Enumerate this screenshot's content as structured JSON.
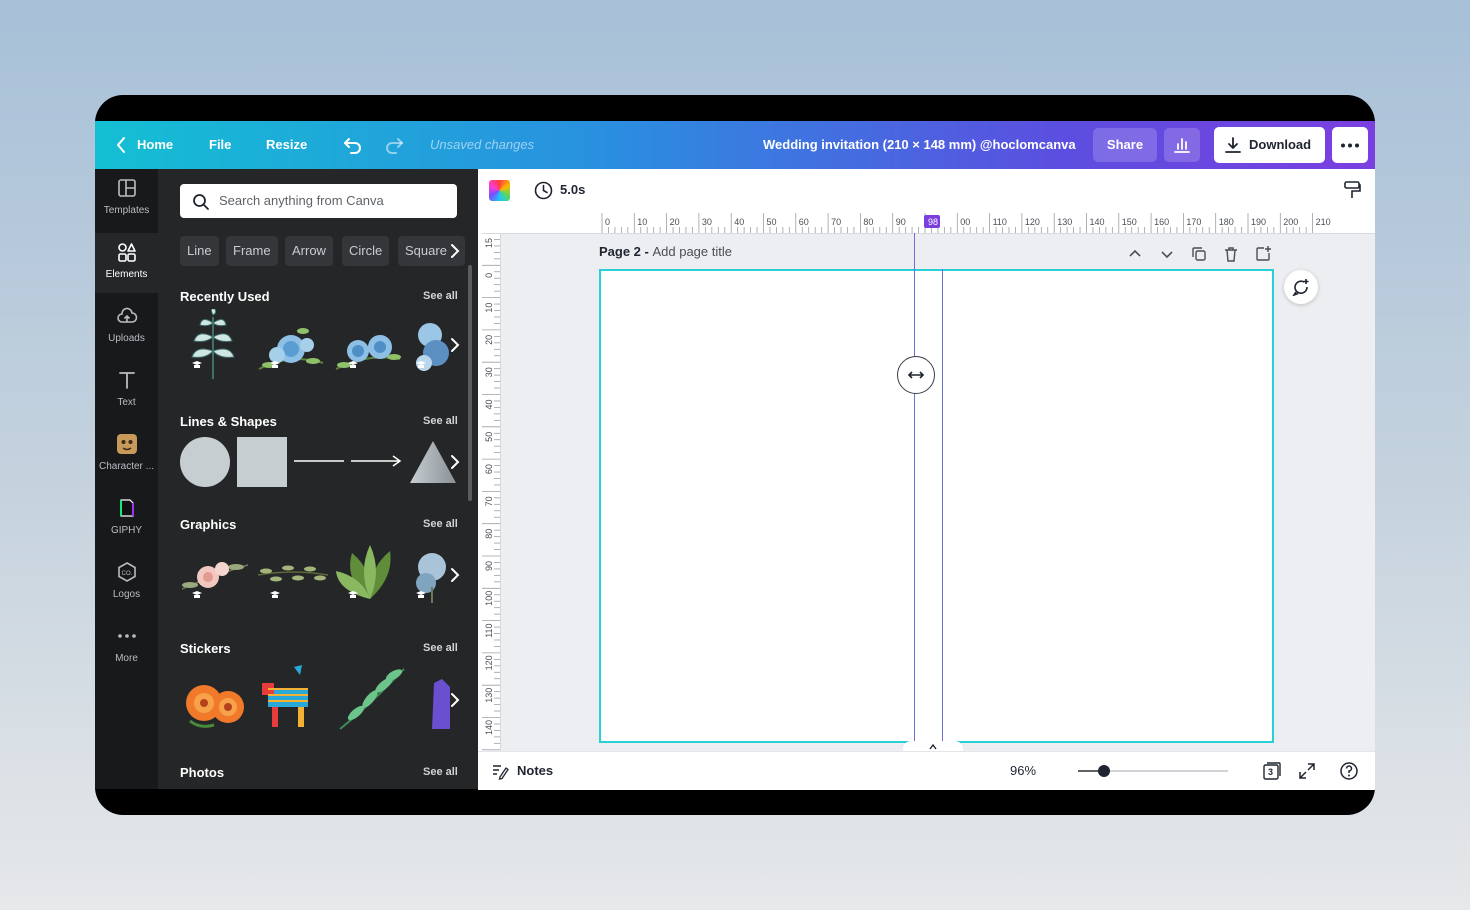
{
  "topbar": {
    "home_label": "Home",
    "file_label": "File",
    "resize_label": "Resize",
    "unsaved": "Unsaved changes",
    "doc_title": "Wedding invitation  (210 × 148 mm) @hoclomcanva",
    "share_label": "Share",
    "download_label": "Download"
  },
  "sidenav": {
    "items": [
      {
        "label": "Templates",
        "icon": "templates-icon"
      },
      {
        "label": "Elements",
        "icon": "elements-icon"
      },
      {
        "label": "Uploads",
        "icon": "upload-cloud-icon"
      },
      {
        "label": "Text",
        "icon": "text-icon"
      },
      {
        "label": "Character ...",
        "icon": "character-icon"
      },
      {
        "label": "GIPHY",
        "icon": "giphy-icon"
      },
      {
        "label": "Logos",
        "icon": "logos-icon"
      },
      {
        "label": "More",
        "icon": "more-dots-icon"
      }
    ]
  },
  "panel": {
    "search_placeholder": "Search anything from Canva",
    "chips": [
      "Line",
      "Frame",
      "Arrow",
      "Circle",
      "Square"
    ],
    "sections": [
      {
        "title": "Recently Used",
        "see_all": "See all"
      },
      {
        "title": "Lines & Shapes",
        "see_all": "See all"
      },
      {
        "title": "Graphics",
        "see_all": "See all"
      },
      {
        "title": "Stickers",
        "see_all": "See all"
      },
      {
        "title": "Photos",
        "see_all": "See all"
      }
    ]
  },
  "editor": {
    "duration": "5.0s",
    "page_label": "Page 2 - ",
    "page_title_placeholder": "Add page title",
    "ruler_top": [
      "0",
      "10",
      "20",
      "30",
      "40",
      "50",
      "60",
      "70",
      "80",
      "90",
      "98",
      "00",
      "110",
      "120",
      "130",
      "140",
      "150",
      "160",
      "170",
      "180",
      "190",
      "200",
      "210"
    ],
    "ruler_left": [
      "15",
      "0",
      "10",
      "20",
      "30",
      "40",
      "50",
      "60",
      "70",
      "80",
      "90",
      "100",
      "110",
      "120",
      "130",
      "140"
    ],
    "ruler_marker": "98"
  },
  "bottombar": {
    "notes_label": "Notes",
    "zoom": "96%",
    "zoom_level": 0.17,
    "page_count": "3"
  },
  "colors": {
    "accent_cyan": "#2ad0d6",
    "guide": "#6c6fd6",
    "ruler_marker": "#7b3fe0"
  }
}
